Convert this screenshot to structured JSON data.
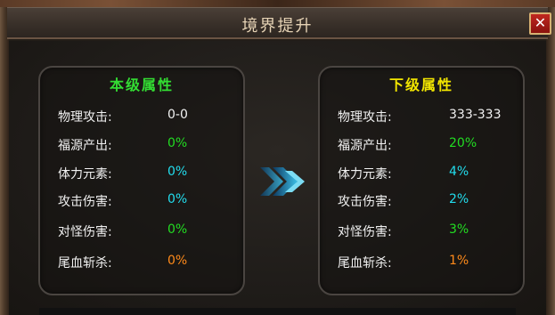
{
  "window": {
    "title": "境界提升",
    "close_label": "✕"
  },
  "colors": {
    "heading_current": "#33dd33",
    "heading_next": "#f2e600",
    "text_white": "#f2f2f2",
    "green": "#22dd22",
    "cyan": "#22ddee",
    "orange": "#ff8a1a"
  },
  "current_level": {
    "heading": "本级属性",
    "rows": [
      {
        "label": "物理攻击:",
        "value": "0-0",
        "color": "#f2f2f2"
      },
      {
        "label": "福源产出:",
        "value": "0%",
        "color": "#22dd22"
      },
      {
        "label": "体力元素:",
        "value": "0%",
        "color": "#22ddee"
      },
      {
        "label": "攻击伤害:",
        "value": "0%",
        "color": "#22ddee"
      },
      {
        "label": "对怪伤害:",
        "value": "0%",
        "color": "#22dd22"
      },
      {
        "label": "尾血斩杀:",
        "value": "0%",
        "color": "#ff8a1a"
      }
    ]
  },
  "next_level": {
    "heading": "下级属性",
    "rows": [
      {
        "label": "物理攻击:",
        "value": "333-333",
        "color": "#f2f2f2"
      },
      {
        "label": "福源产出:",
        "value": "20%",
        "color": "#22dd22"
      },
      {
        "label": "体力元素:",
        "value": "4%",
        "color": "#22ddee"
      },
      {
        "label": "攻击伤害:",
        "value": "2%",
        "color": "#22ddee"
      },
      {
        "label": "对怪伤害:",
        "value": "3%",
        "color": "#22dd22"
      },
      {
        "label": "尾血斩杀:",
        "value": "1%",
        "color": "#ff8a1a"
      }
    ]
  },
  "icons": {
    "arrow": "double-chevron-right-icon",
    "close": "close-icon"
  }
}
